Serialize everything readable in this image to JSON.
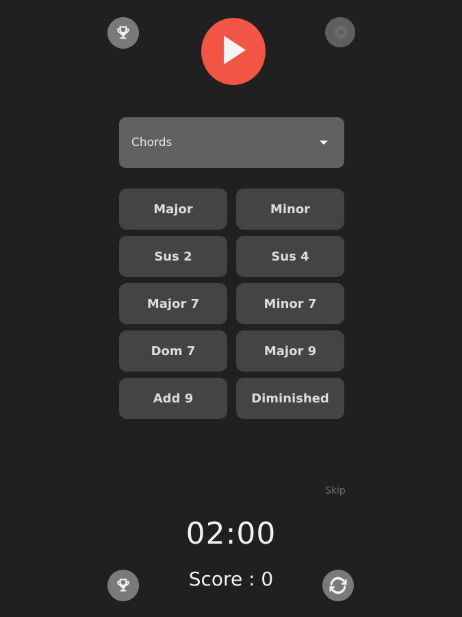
{
  "header": {
    "play_icon": "play-icon",
    "trophy_icon": "trophy-icon",
    "settings_icon": "gear-icon"
  },
  "mode_select": {
    "value": "Chords"
  },
  "chords": [
    "Major",
    "Minor",
    "Sus 2",
    "Sus 4",
    "Major 7",
    "Minor 7",
    "Dom 7",
    "Major 9",
    "Add 9",
    "Diminished"
  ],
  "skip_label": "Skip",
  "timer": "02:00",
  "score": {
    "label": "Score : 0"
  },
  "colors": {
    "background": "#202020",
    "accent": "#f35545",
    "button": "#444444",
    "dropdown": "#616161",
    "icon_circle": "#7a7a7a"
  }
}
